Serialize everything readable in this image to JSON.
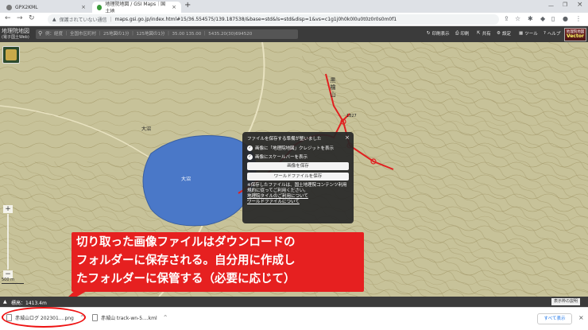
{
  "browser": {
    "tabs": [
      {
        "title": "GPX2KML"
      },
      {
        "title": "地理院地図 / GSI Maps｜国土地"
      }
    ],
    "new_tab": "+",
    "address": {
      "security_label": "保護されていない通信",
      "url": "maps.gsi.go.jp/index.html#15/36.554575/139.187538/&base=std&ls=std&disp=1&vs=c1g1j0h0k0l0u0t0z0r0s0m0f1"
    }
  },
  "gsi": {
    "logo_title": "地理院地図",
    "logo_subtitle": "(電子国土Web)",
    "search_text": "例：経度 ｜ 全国市区町村 ｜ 25地図の1分 ｜ 125地図の1分 ｜ 35.00 135.00 ｜ 5435.20(30)694520",
    "menu": [
      "機能",
      "共有",
      "設定",
      "ツール",
      "ヘルプ"
    ],
    "menu_left": "印刷表示",
    "menu_print": "印刷",
    "vector_label": "地理院地図",
    "vector_badge": "Vector"
  },
  "map": {
    "labels": {
      "lake": "大沼",
      "mountain": "黒檜山",
      "place1": "大沼",
      "pt": "1827"
    },
    "scale_label": "500 m",
    "zoom_in": "+",
    "zoom_out": "−"
  },
  "dialog": {
    "title": "ファイルを保存する準備が整いました",
    "option1": "画像に「地理院地図」クレジットを表示",
    "option2": "画像にスケールバーを表示",
    "button_save_image": "画像を保存",
    "button_save_world": "ワールドファイルを保存",
    "note": "※保存したファイルは、国土地理院コンテンツ利用規約に従ってご利用ください。",
    "link1": "地理院タイルのご利用について",
    "link2": "ワールドファイルについて",
    "close": "×"
  },
  "callout": {
    "lines": [
      "切り取った画像ファイルはダウンロードの",
      "フォルダーに保存される。自分用に作成し",
      "たフォルダーに保管する（必要に応じて）"
    ]
  },
  "status": {
    "elevation": "標高：1413.4m",
    "right_button": "表示枠の説明"
  },
  "downloads": {
    "items": [
      {
        "name": "赤城山ログ 202301....png"
      },
      {
        "name": "赤城山 track-wn-5....kml"
      }
    ],
    "show_all": "すべて表示"
  },
  "colors": {
    "map_base": "#c7c299",
    "lake": "#4a78c8",
    "route": "#e02020",
    "callout": "#e62020"
  }
}
